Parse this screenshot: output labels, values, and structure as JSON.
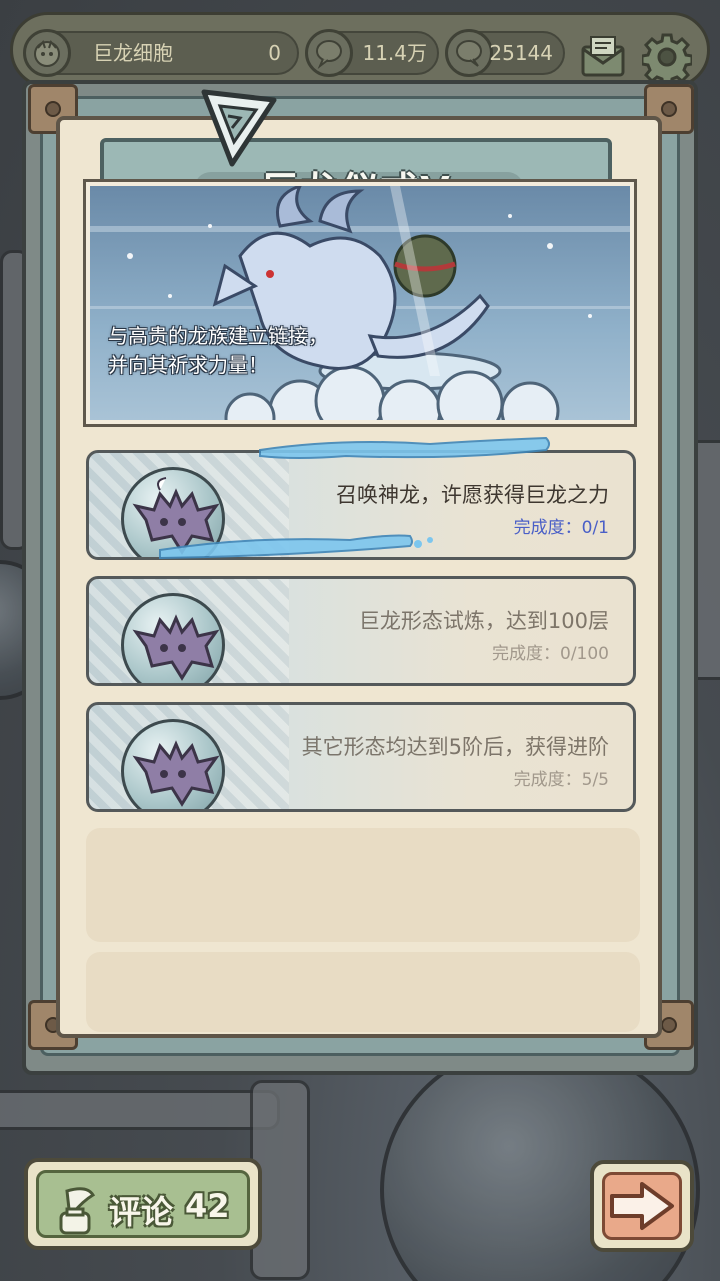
{
  "topbar": {
    "resource": {
      "name": "巨龙细胞",
      "value": "0",
      "icon": "dragon-cell-icon"
    },
    "views": {
      "value": "11.4万",
      "icon": "speech-bubble-icon"
    },
    "comments": {
      "value": "25144",
      "icon": "chat-bubble-icon"
    },
    "mail_icon": "mail-icon",
    "settings_icon": "gear-icon"
  },
  "panel": {
    "title": "巨龙仪式V",
    "description_line1": "与高贵的龙族建立链接，",
    "description_line2": "并向其祈求力量！"
  },
  "quests": [
    {
      "title": "召唤神龙，许愿获得巨龙之力",
      "progress": "完成度：0/1",
      "state": "active"
    },
    {
      "title": "巨龙形态试炼，达到100层",
      "progress": "完成度：0/100",
      "state": "faded"
    },
    {
      "title": "其它形态均达到5阶后，获得进阶",
      "progress": "完成度：5/5",
      "state": "faded"
    }
  ],
  "footer": {
    "comment_label": "评论",
    "comment_count": "42",
    "next_icon": "arrow-right-icon"
  },
  "colors": {
    "progress_active": "#4a5fc7",
    "panel_bg": "#efe6d1",
    "title_band": "#9cb8b5"
  }
}
